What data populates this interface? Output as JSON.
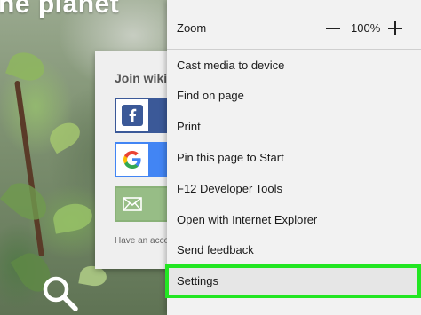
{
  "background": {
    "heading": "he planet"
  },
  "join_card": {
    "title": "Join wiki",
    "facebook_icon": "facebook-icon",
    "google_icon": "google-icon",
    "email_icon": "email-icon",
    "footer_text": "Have an acco"
  },
  "menu": {
    "zoom": {
      "label": "Zoom",
      "value": "100%",
      "minus_icon": "minus-icon",
      "plus_icon": "plus-icon"
    },
    "items": [
      {
        "label": "Cast media to device"
      },
      {
        "label": "Find on page"
      },
      {
        "label": "Print"
      },
      {
        "label": "Pin this page to Start"
      },
      {
        "label": "F12 Developer Tools"
      },
      {
        "label": "Open with Internet Explorer"
      },
      {
        "label": "Send feedback"
      },
      {
        "label": "Settings",
        "highlighted": true
      }
    ]
  },
  "colors": {
    "highlight_outline": "#22e622",
    "facebook": "#3b5998",
    "google_blue": "#4285f4",
    "email_green": "#97bd86"
  }
}
